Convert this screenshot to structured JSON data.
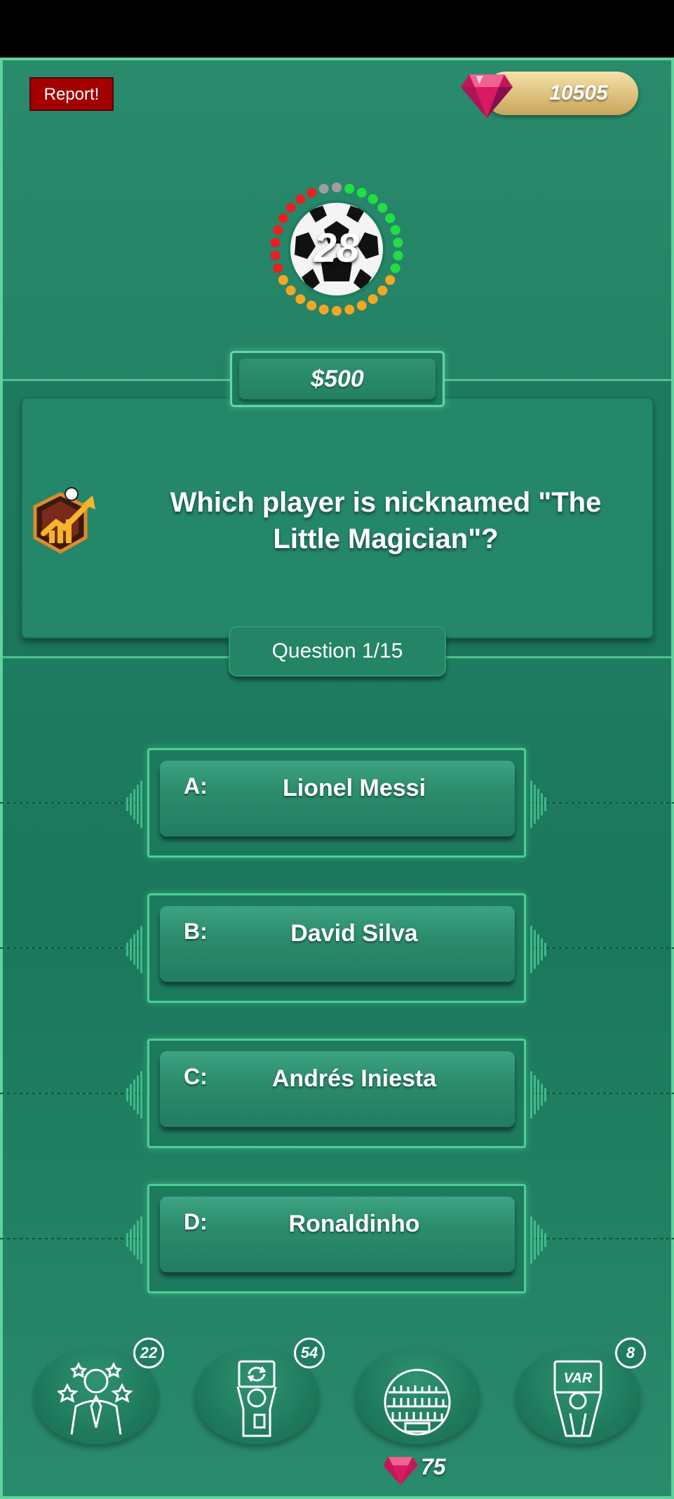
{
  "header": {
    "report_label": "Report!",
    "gems_balance": "10505"
  },
  "timer": {
    "seconds": "28"
  },
  "prize": {
    "amount": "$500"
  },
  "question": {
    "text": "Which player is nicknamed \"The Little Magician\"?",
    "counter": "Question 1/15"
  },
  "answers": [
    {
      "letter": "A:",
      "text": "Lionel Messi"
    },
    {
      "letter": "B:",
      "text": "David Silva"
    },
    {
      "letter": "C:",
      "text": "Andrés Iniesta"
    },
    {
      "letter": "D:",
      "text": "Ronaldinho"
    }
  ],
  "lifelines": [
    {
      "icon": "manager-icon",
      "count": "22"
    },
    {
      "icon": "substitution-icon",
      "count": "54"
    },
    {
      "icon": "crowd-icon",
      "count": ""
    },
    {
      "icon": "var-icon",
      "count": "8"
    }
  ],
  "lifeline_cost": "75",
  "colors": {
    "accent": "#5fd39b",
    "report": "#a30000",
    "gem": "#c2185b"
  }
}
